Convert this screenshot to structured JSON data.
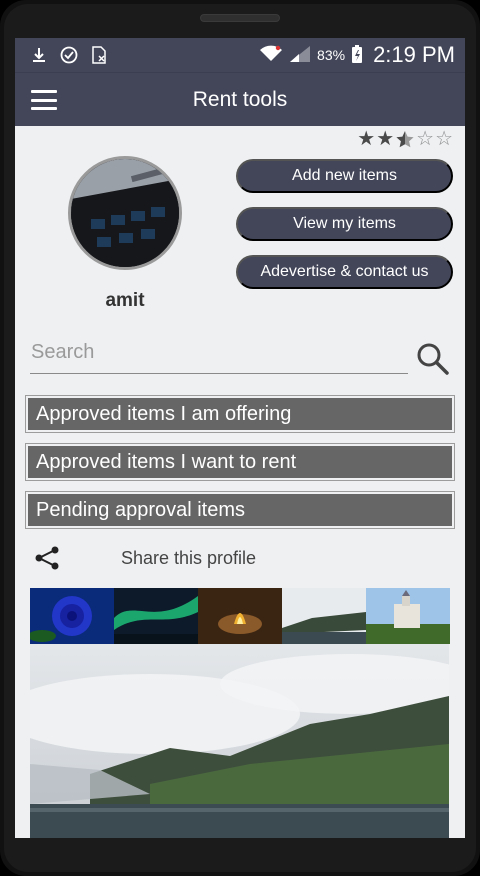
{
  "status_bar": {
    "icons": [
      "download-icon",
      "check-circle-icon",
      "file-x-icon",
      "wifi-icon",
      "signal-icon",
      "battery-charging-icon"
    ],
    "battery_percent": "83%",
    "time": "2:19 PM"
  },
  "app_bar": {
    "title": "Rent tools"
  },
  "profile": {
    "rating": 2.5,
    "rating_max": 5,
    "username": "amit"
  },
  "actions": {
    "add_new_items": "Add new items",
    "view_my_items": "View my items",
    "advertise_contact": "Adevertise & contact us"
  },
  "search": {
    "placeholder": "Search",
    "value": ""
  },
  "sections": {
    "offering": "Approved items I am offering",
    "want_to_rent": "Approved items I want to rent",
    "pending": "Pending approval items"
  },
  "share": {
    "label": "Share this profile"
  },
  "gallery": {
    "thumbnails": [
      "blue rose",
      "aurora",
      "campfire",
      "misty lake",
      "castle"
    ]
  },
  "colors": {
    "primary": "#434659",
    "section_bar": "#666666",
    "background": "#eef0f2"
  }
}
